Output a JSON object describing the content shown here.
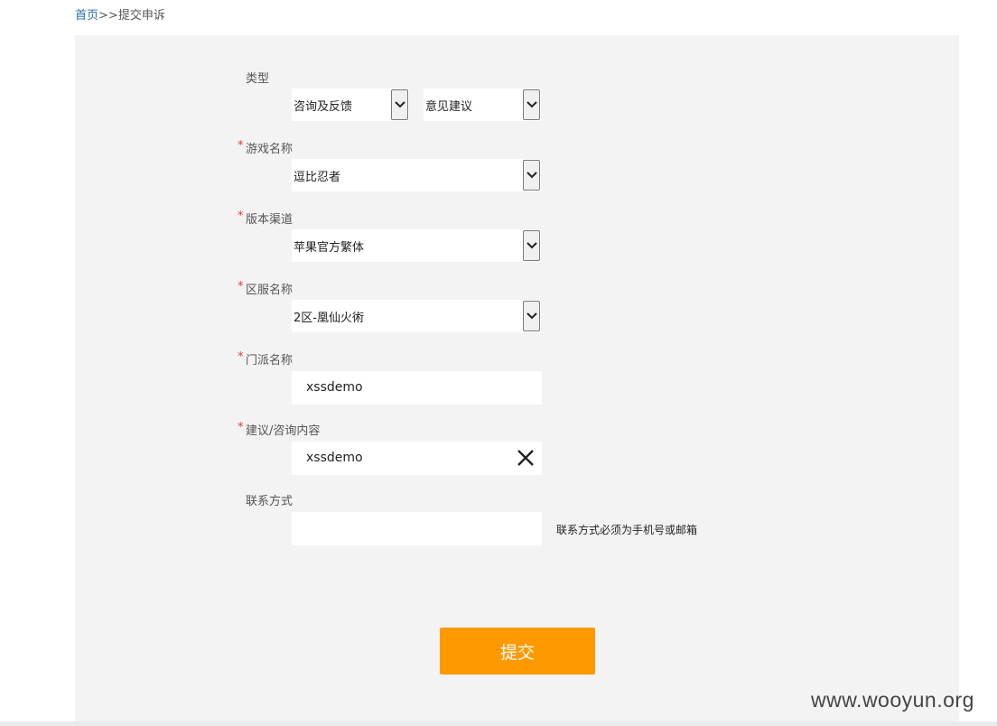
{
  "breadcrumb": {
    "home": "首页",
    "separator": ">>",
    "current": "提交申诉"
  },
  "form": {
    "type": {
      "label": "类型",
      "category": "咨询及反馈",
      "subcategory": "意见建议"
    },
    "game": {
      "label": "游戏名称",
      "value": "逗比忍者"
    },
    "channel": {
      "label": "版本渠道",
      "value": "苹果官方繁体"
    },
    "server": {
      "label": "区服名称",
      "value": "2区-凰仙火術"
    },
    "faction": {
      "label": "门派名称",
      "value": "xssdemo"
    },
    "content": {
      "label": "建议/咨询内容",
      "value": "xssdemo"
    },
    "contact": {
      "label": "联系方式",
      "value": "",
      "hint": "联系方式必须为手机号或邮箱"
    },
    "required_mark": "*",
    "submit_label": "提交"
  },
  "watermark": "www.wooyun.org",
  "colors": {
    "accent": "#ff9900",
    "required": "#e4393c",
    "link": "#2a6eb0",
    "panel": "#f3f3f3"
  }
}
